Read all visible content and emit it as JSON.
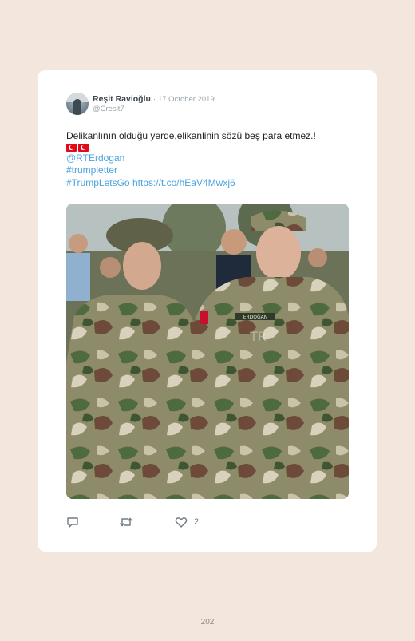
{
  "tweet": {
    "author_name": "Reşit Ravioğlu",
    "separator": "·",
    "date": "17 October 2019",
    "handle": "@Cresit7",
    "text": "Delikanlının olduğu yerde,elikanlinin sözü beş para etmez.!",
    "mention": "@RTErdogan",
    "hashtag_1": "#trumpletter",
    "hashtag_2": "#TrumpLetsGo",
    "url": "https://t.co/hEaV4Mwxj6",
    "photo_name_tag": "ERDOĞAN",
    "photo_watermark": "TR",
    "likes_count": "2"
  },
  "icons": [
    "reply-icon",
    "retweet-icon",
    "like-icon",
    "turkish-flag-icon"
  ],
  "colors": {
    "background": "#f3e6dc",
    "card": "#ffffff",
    "link": "#4aa3df",
    "meta_text": "#9aa6ad"
  },
  "page": {
    "number": "202"
  }
}
